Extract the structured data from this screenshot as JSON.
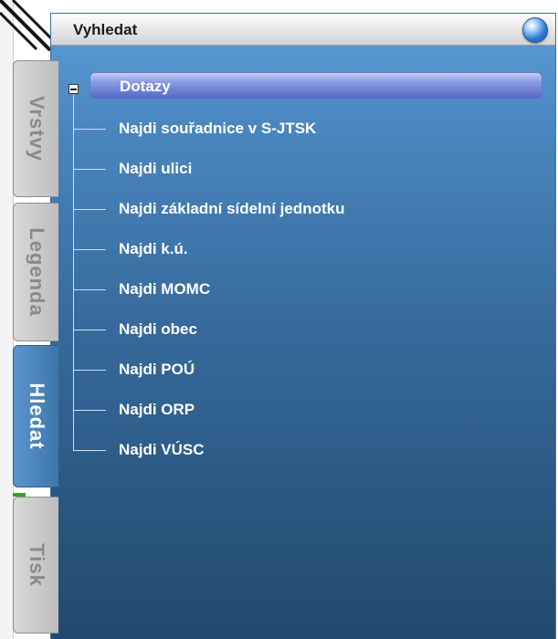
{
  "panel": {
    "title": "Vyhledat"
  },
  "tabs": [
    {
      "label": "Vrstvy",
      "active": false
    },
    {
      "label": "Legenda",
      "active": false
    },
    {
      "label": "Hledat",
      "active": true
    },
    {
      "label": "Tisk",
      "active": false
    }
  ],
  "tree": {
    "root": {
      "label": "Dotazy",
      "expanded": true
    },
    "items": [
      "Najdi souřadnice v S-JTSK",
      "Najdi ulici",
      "Najdi základní sídelní jednotku",
      "Najdi k.ú.",
      "Najdi MOMC",
      "Najdi obec",
      "Najdi POÚ",
      "Najdi ORP",
      "Najdi VÚSC"
    ]
  },
  "icons": {
    "header_orb": "info-orb-icon",
    "collapse": "minus-box-icon"
  },
  "colors": {
    "panel_top": "#5c9ed8",
    "panel_bottom": "#22496d",
    "highlight": "#5167c6",
    "active_tab": "#4a84bd"
  }
}
